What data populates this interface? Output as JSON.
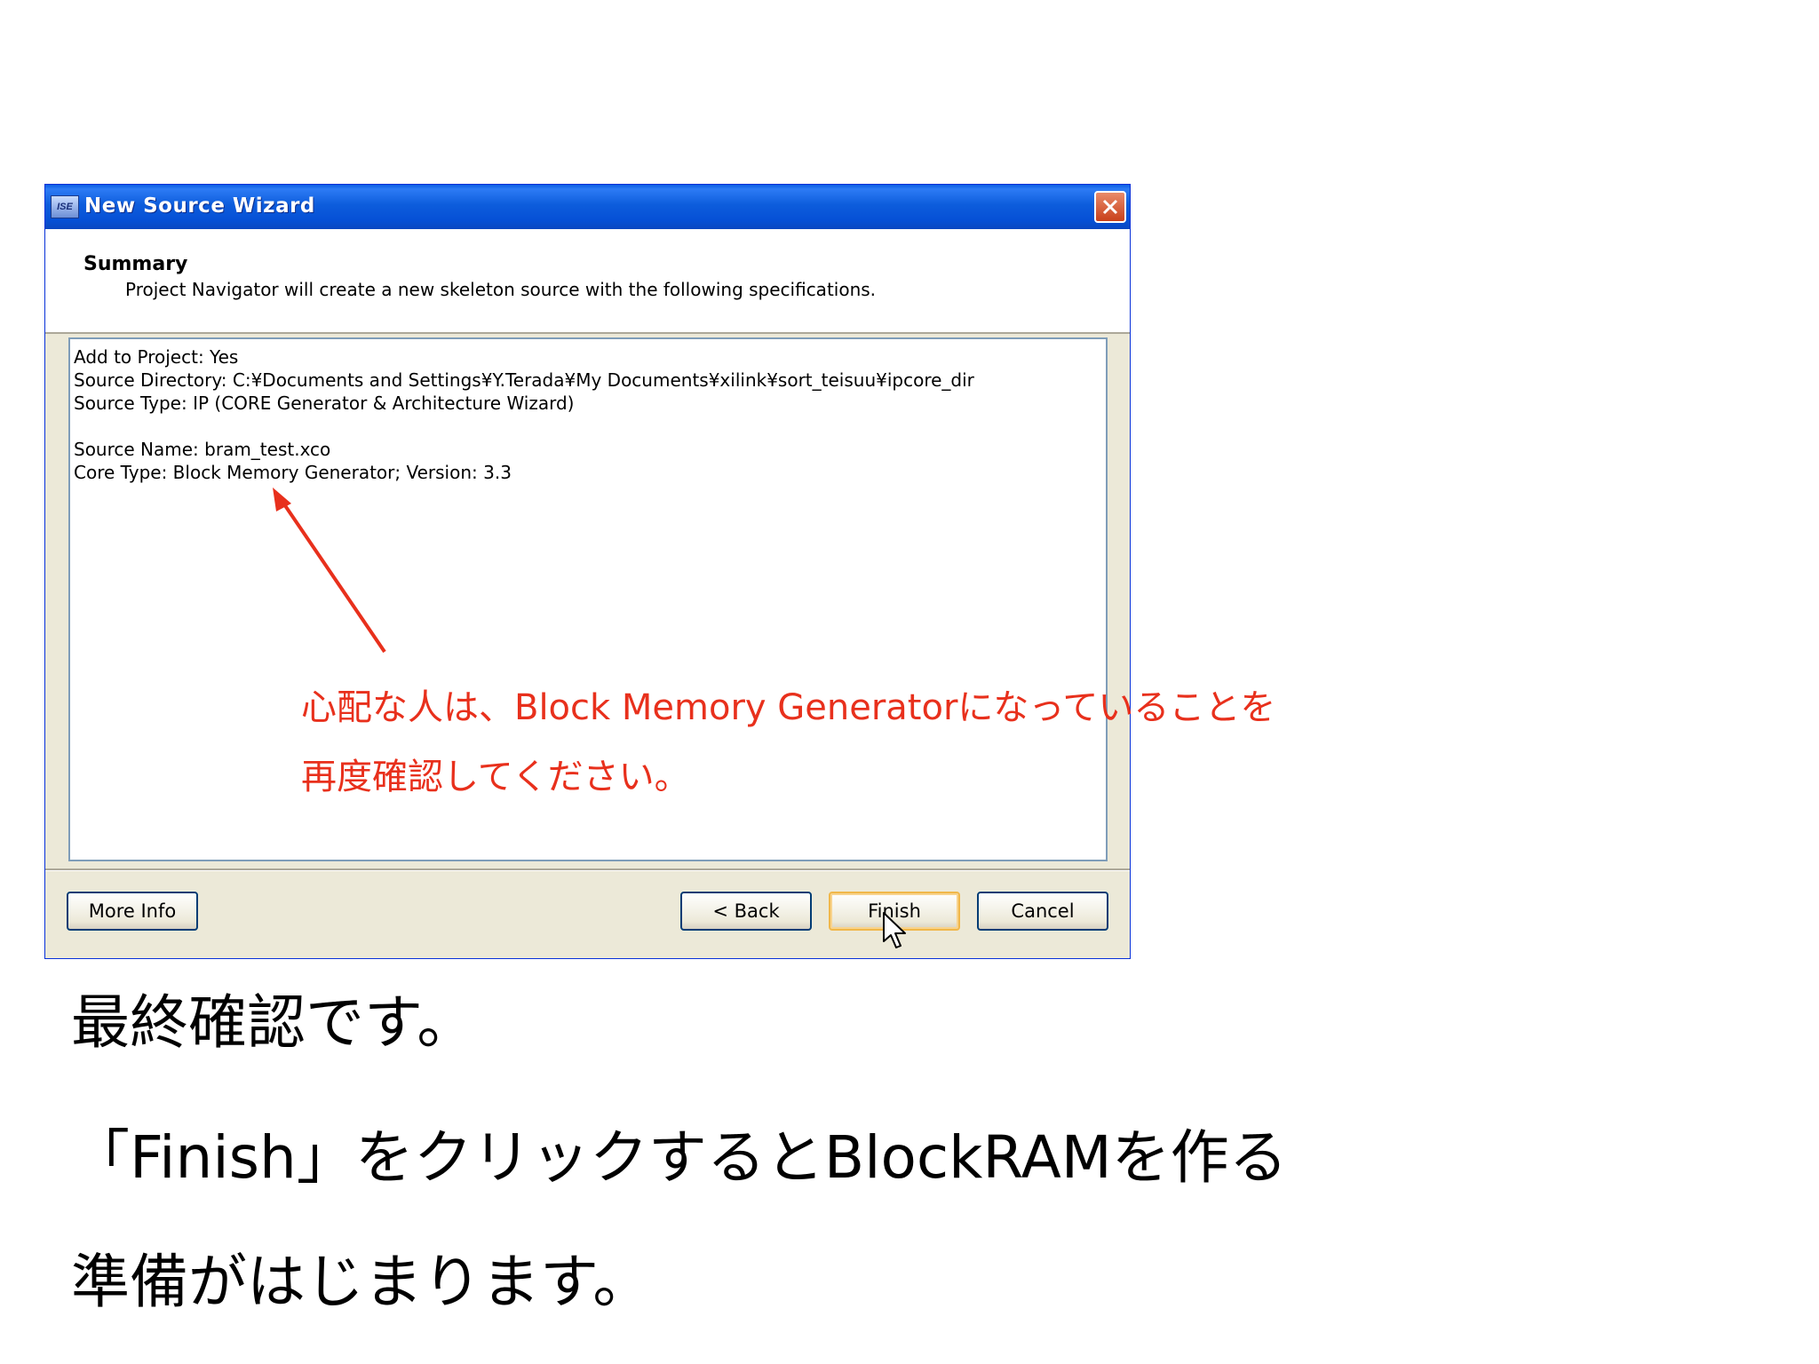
{
  "dialog": {
    "title": "New Source Wizard",
    "icon": "ise-app-icon",
    "header": {
      "title": "Summary",
      "description": "Project Navigator will create a new skeleton source with the following specifications."
    },
    "spec_lines": [
      "Add to Project: Yes",
      "Source Directory: C:¥Documents and Settings¥Y.Terada¥My Documents¥xilink¥sort_teisuu¥ipcore_dir",
      "Source Type: IP (CORE Generator & Architecture Wizard)",
      "Source Name: bram_test.xco",
      "Core Type: Block Memory Generator; Version: 3.3"
    ],
    "buttons": {
      "more_info": "More Info",
      "back": "< Back",
      "finish": "Finish",
      "cancel": "Cancel"
    }
  },
  "annotation": {
    "line1": "心配な人は、Block Memory Generatorになっていることを",
    "line2": "再度確認してください。",
    "color": "#e8301c"
  },
  "caption": {
    "line1": "最終確認です。",
    "line2": "「Finish」をクリックするとBlockRAMを作る",
    "line3": "準備がはじまります。"
  }
}
